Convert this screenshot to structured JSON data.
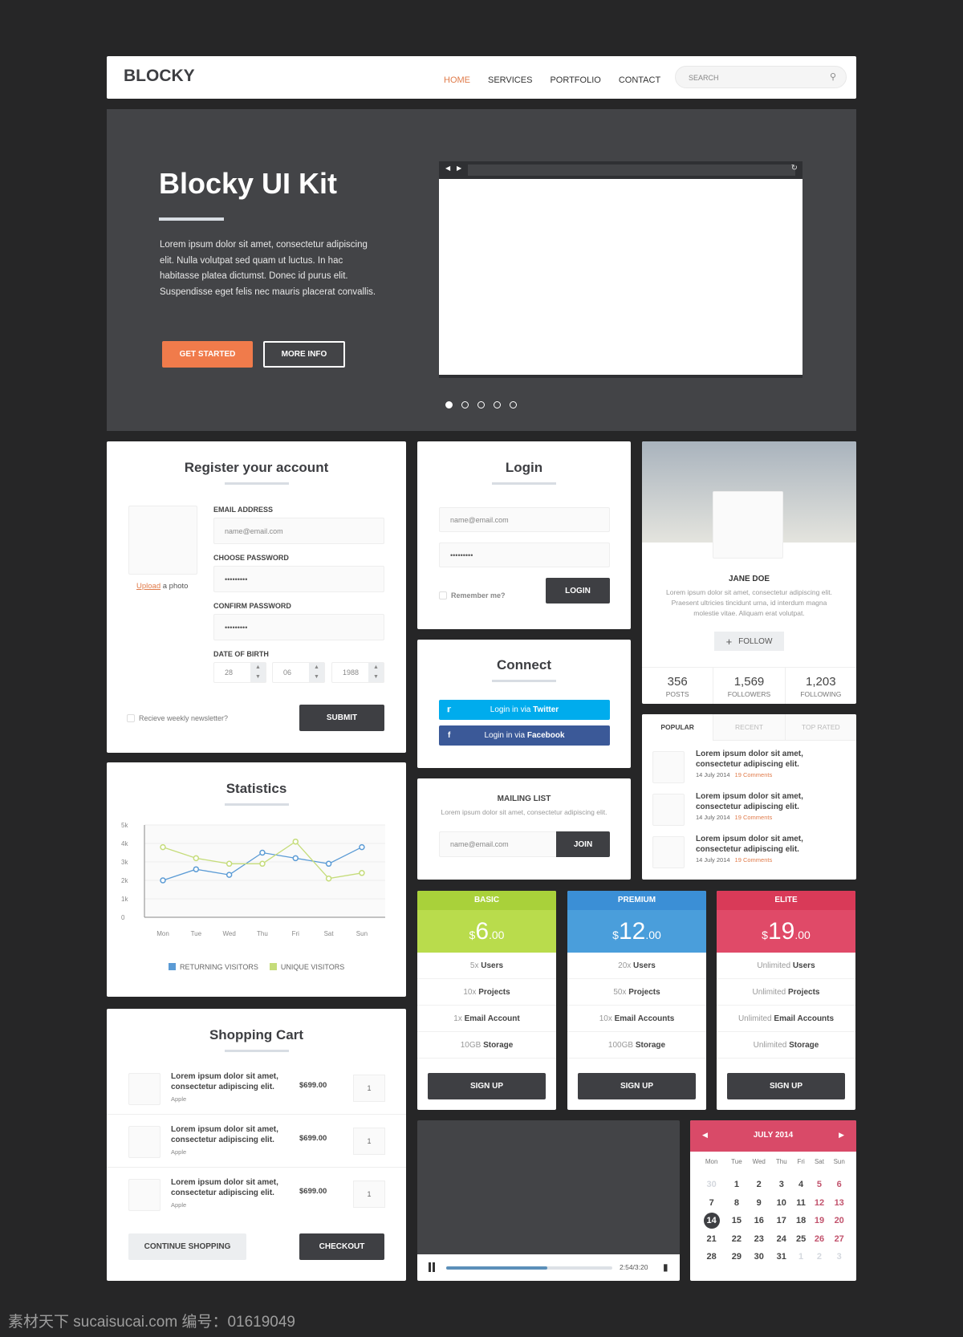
{
  "header": {
    "logo": "BLOCKY",
    "nav": [
      "HOME",
      "SERVICES",
      "PORTFOLIO",
      "CONTACT"
    ],
    "active": "HOME",
    "search_placeholder": "SEARCH"
  },
  "hero": {
    "title": "Blocky UI Kit",
    "text": "Lorem ipsum dolor sit amet, consectetur adipiscing elit. Nulla volutpat sed quam ut luctus. In hac habitasse platea dictumst. Donec id purus elit. Suspendisse eget felis nec mauris placerat convallis.",
    "primary": "GET STARTED",
    "secondary": "MORE INFO",
    "slides": 5,
    "active_slide": 1,
    "accent": "#f07b4b"
  },
  "register": {
    "title": "Register your account",
    "upload_link": "Upload",
    "upload_rest": " a photo",
    "email_label": "EMAIL ADDRESS",
    "email_placeholder": "name@email.com",
    "password_label": "CHOOSE PASSWORD",
    "password": "•••••••••",
    "confirm_label": "CONFIRM PASSWORD",
    "confirm": "•••••••••",
    "dob_label": "DATE OF BIRTH",
    "day": "28",
    "month": "06",
    "year": "1988",
    "newsletter": "Recieve weekly newsletter?",
    "submit": "SUBMIT"
  },
  "login": {
    "title": "Login",
    "email_placeholder": "name@email.com",
    "password": "•••••••••",
    "remember": "Remember me?",
    "button": "LOGIN"
  },
  "connect": {
    "title": "Connect",
    "twitter_pre": "Login in via ",
    "twitter": "Twitter",
    "facebook_pre": "Login in via ",
    "facebook": "Facebook",
    "twitter_color": "#00aced",
    "facebook_color": "#3b5998"
  },
  "mailing": {
    "title": "MAILING LIST",
    "text": "Lorem ipsum dolor sit amet, consectetur adipiscing elit.",
    "placeholder": "name@email.com",
    "button": "JOIN"
  },
  "profile": {
    "name": "JANE DOE",
    "bio": "Lorem ipsum dolor sit amet, consectetur adipiscing elit. Praesent ultricies tincidunt urna, id interdum magna molestie vitae. Aliquam erat volutpat.",
    "follow": "FOLLOW",
    "stats": [
      {
        "value": "356",
        "label": "POSTS"
      },
      {
        "value": "1,569",
        "label": "FOLLOWERS"
      },
      {
        "value": "1,203",
        "label": "FOLLOWING"
      }
    ]
  },
  "posts": {
    "tabs": [
      "POPULAR",
      "RECENT",
      "TOP RATED"
    ],
    "active": "POPULAR",
    "items": [
      {
        "title": "Lorem ipsum dolor sit amet, consectetur adipiscing elit.",
        "date": "14 July 2014",
        "comments": "19 Comments"
      },
      {
        "title": "Lorem ipsum dolor sit amet, consectetur adipiscing elit.",
        "date": "14 July 2014",
        "comments": "19 Comments"
      },
      {
        "title": "Lorem ipsum dolor sit amet, consectetur adipiscing elit.",
        "date": "14 July 2014",
        "comments": "19 Comments"
      }
    ]
  },
  "statistics": {
    "title": "Statistics"
  },
  "chart_data": {
    "type": "line",
    "categories": [
      "Mon",
      "Tue",
      "Wed",
      "Thu",
      "Fri",
      "Sat",
      "Sun"
    ],
    "yticks": [
      "0",
      "1k",
      "2k",
      "3k",
      "4k",
      "5k"
    ],
    "ylim": [
      0,
      5000
    ],
    "grid": true,
    "legend": "bottom",
    "series": [
      {
        "name": "RETURNING VISITORS",
        "color": "#5b9bd5",
        "values": [
          2000,
          2600,
          2300,
          3500,
          3200,
          2900,
          3800
        ]
      },
      {
        "name": "UNIQUE VISITORS",
        "color": "#c5dc7a",
        "values": [
          3800,
          3200,
          2900,
          2900,
          4100,
          2100,
          2400
        ]
      }
    ]
  },
  "cart": {
    "title": "Shopping Cart",
    "items": [
      {
        "name": "Lorem ipsum dolor sit amet, consectetur adipiscing elit.",
        "brand": "Apple",
        "price": "$699.00",
        "qty": "1"
      },
      {
        "name": "Lorem ipsum dolor sit amet, consectetur adipiscing elit.",
        "brand": "Apple",
        "price": "$699.00",
        "qty": "1"
      },
      {
        "name": "Lorem ipsum dolor sit amet, consectetur adipiscing elit.",
        "brand": "Apple",
        "price": "$699.00",
        "qty": "1"
      }
    ],
    "continue": "CONTINUE SHOPPING",
    "checkout": "CHECKOUT"
  },
  "pricing": [
    {
      "name": "BASIC",
      "currency": "$",
      "amount": "6",
      "cents": ".00",
      "color": "#a9d13a",
      "price_color": "#b9dc4c",
      "features": [
        [
          "5x",
          "Users"
        ],
        [
          "10x",
          "Projects"
        ],
        [
          "1x",
          "Email Account"
        ],
        [
          "10GB",
          "Storage"
        ]
      ],
      "button": "SIGN UP"
    },
    {
      "name": "PREMIUM",
      "currency": "$",
      "amount": "12",
      "cents": ".00",
      "color": "#3b8fd6",
      "price_color": "#4a9edb",
      "features": [
        [
          "20x",
          "Users"
        ],
        [
          "50x",
          "Projects"
        ],
        [
          "10x",
          "Email Accounts"
        ],
        [
          "100GB",
          "Storage"
        ]
      ],
      "button": "SIGN UP"
    },
    {
      "name": "ELITE",
      "currency": "$",
      "amount": "19",
      "cents": ".00",
      "color": "#d93a58",
      "price_color": "#e04a68",
      "features": [
        [
          "Unlimited",
          "Users"
        ],
        [
          "Unlimited",
          "Projects"
        ],
        [
          "Unlimited",
          "Email Accounts"
        ],
        [
          "Unlimited",
          "Storage"
        ]
      ],
      "button": "SIGN UP"
    }
  ],
  "video": {
    "time": "2:54/3:20",
    "progress": 0.61
  },
  "calendar": {
    "title": "JULY 2014",
    "days": [
      "Mon",
      "Tue",
      "Wed",
      "Thu",
      "Fri",
      "Sat",
      "Sun"
    ],
    "weeks": [
      [
        "30",
        "1",
        "2",
        "3",
        "4",
        "5",
        "6"
      ],
      [
        "7",
        "8",
        "9",
        "10",
        "11",
        "12",
        "13"
      ],
      [
        "14",
        "15",
        "16",
        "17",
        "18",
        "19",
        "20"
      ],
      [
        "21",
        "22",
        "23",
        "24",
        "25",
        "26",
        "27"
      ],
      [
        "28",
        "29",
        "30",
        "31",
        "1",
        "2",
        "3"
      ]
    ],
    "selected": "14",
    "accent": "#d94a68"
  },
  "watermark": "素材天下 sucaisucai.com  编号：01619049"
}
